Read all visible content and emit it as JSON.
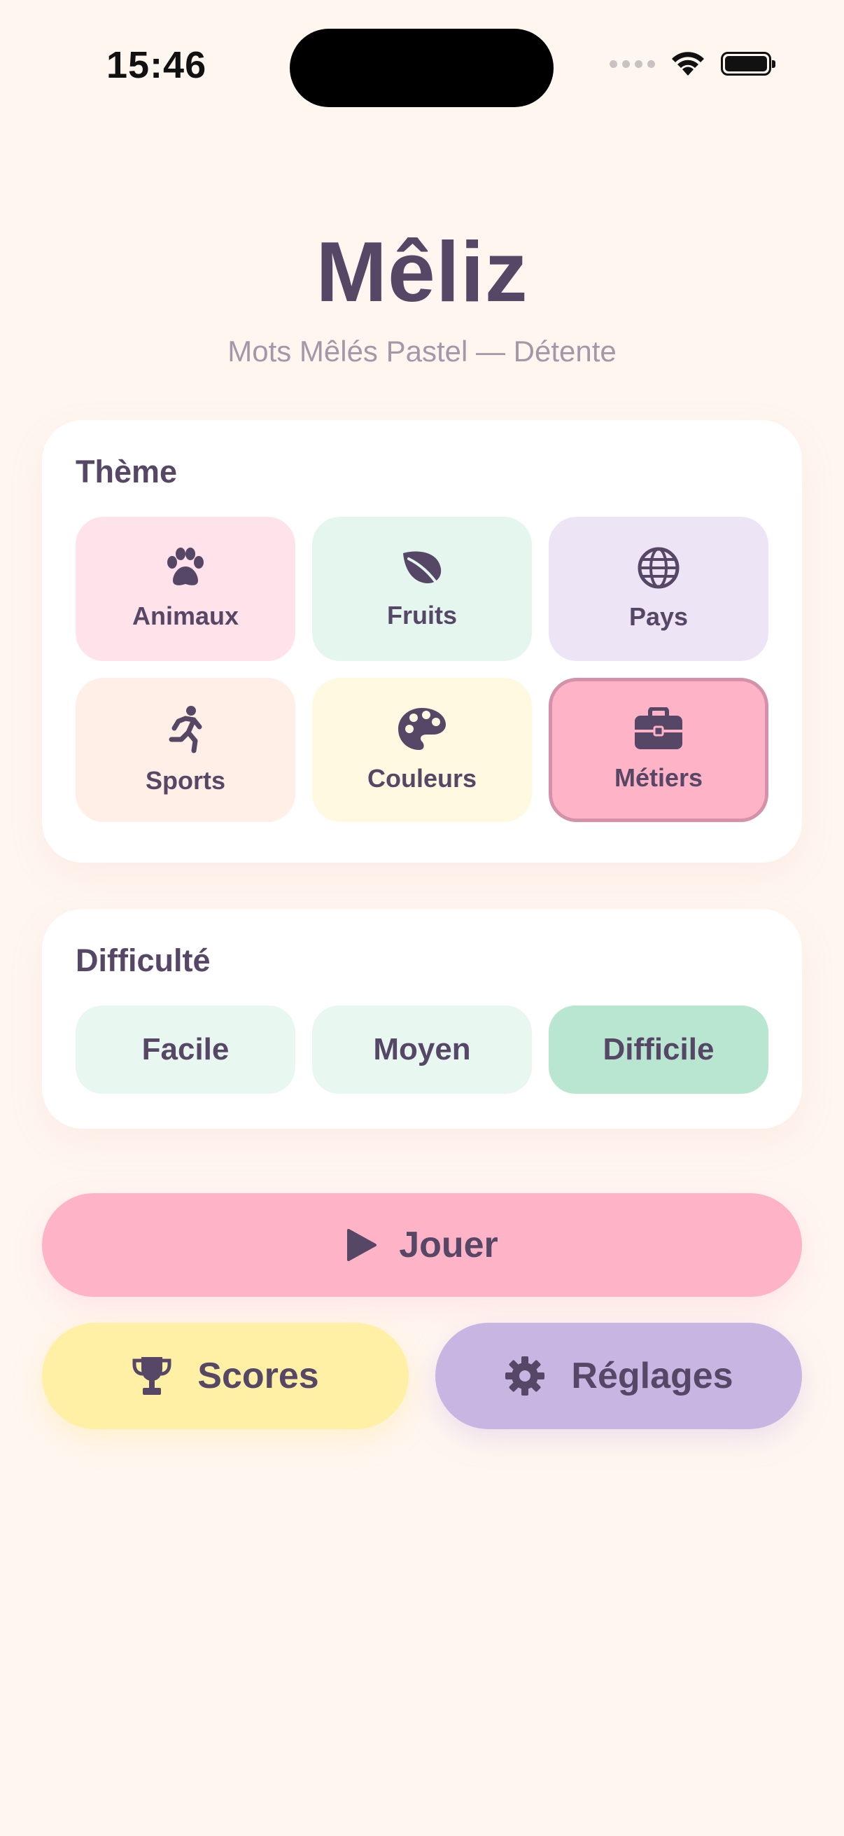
{
  "status_bar": {
    "time": "15:46"
  },
  "header": {
    "title": "Mêliz",
    "subtitle": "Mots Mêlés Pastel — Détente"
  },
  "theme_section": {
    "title": "Thème",
    "items": [
      {
        "label": "Animaux",
        "icon": "paw-icon",
        "color": "#FFE2EA",
        "selected": false
      },
      {
        "label": "Fruits",
        "icon": "leaf-icon",
        "color": "#E5F6EF",
        "selected": false
      },
      {
        "label": "Pays",
        "icon": "globe-icon",
        "color": "#EDE4F6",
        "selected": false
      },
      {
        "label": "Sports",
        "icon": "running-icon",
        "color": "#FFEFE6",
        "selected": false
      },
      {
        "label": "Couleurs",
        "icon": "palette-icon",
        "color": "#FFF9E2",
        "selected": false
      },
      {
        "label": "Métiers",
        "icon": "briefcase-icon",
        "color": "#FFB3C6",
        "selected": true
      }
    ]
  },
  "difficulty_section": {
    "title": "Difficulté",
    "options": [
      {
        "label": "Facile",
        "selected": false
      },
      {
        "label": "Moyen",
        "selected": false
      },
      {
        "label": "Difficile",
        "selected": true
      }
    ]
  },
  "actions": {
    "play_label": "Jouer",
    "scores_label": "Scores",
    "settings_label": "Réglages"
  },
  "colors": {
    "background": "#FFF6F0",
    "text": "#564766",
    "play": "#FFB3C6",
    "scores": "#FFF0A6",
    "settings": "#C8B5E1",
    "difficulty_selected": "#B8E6D1"
  }
}
